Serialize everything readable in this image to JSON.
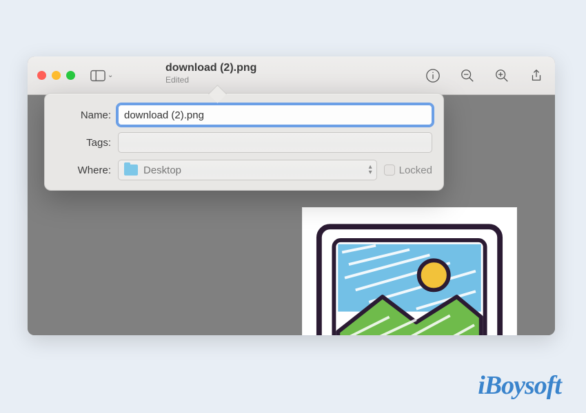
{
  "titlebar": {
    "title": "download (2).png",
    "subtitle": "Edited"
  },
  "toolbar": {
    "info_icon": "info-icon",
    "zoom_out_icon": "zoom-out-icon",
    "zoom_in_icon": "zoom-in-icon",
    "share_icon": "share-icon"
  },
  "popover": {
    "name_label": "Name:",
    "name_value": "download (2).png",
    "tags_label": "Tags:",
    "tags_value": "",
    "where_label": "Where:",
    "where_value": "Desktop",
    "locked_label": "Locked"
  },
  "image": {
    "desc": "sketch-style picture icon with mountain and sun"
  },
  "watermark": "iBoysoft"
}
